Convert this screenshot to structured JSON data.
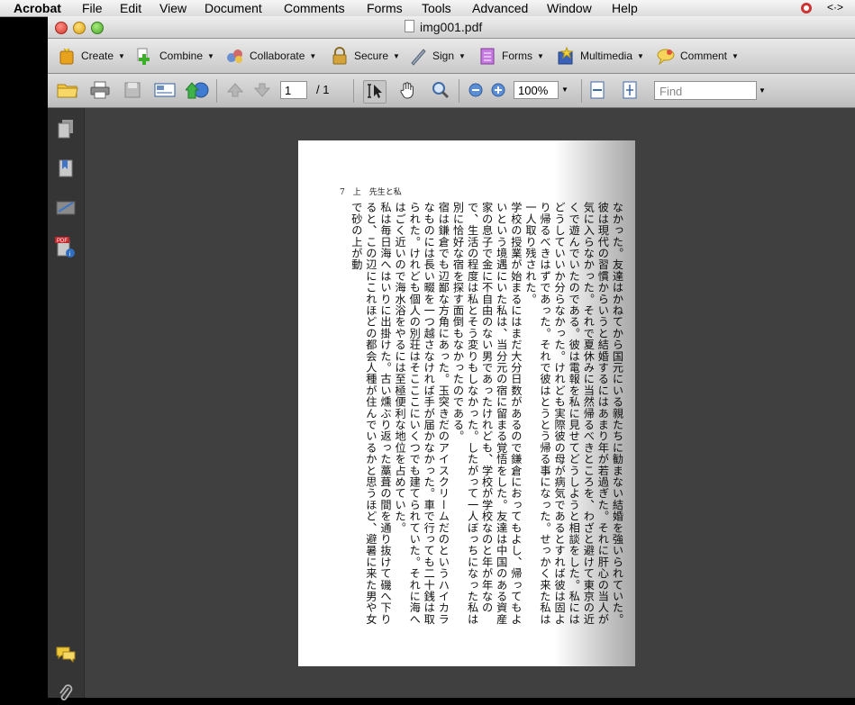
{
  "menubar": {
    "app_name": "Acrobat",
    "items": [
      "File",
      "Edit",
      "View",
      "Document",
      "Comments",
      "Forms",
      "Tools",
      "Advanced",
      "Window",
      "Help"
    ],
    "right_symbol": "<·>"
  },
  "window": {
    "title": "img001.pdf"
  },
  "toolbar1": [
    {
      "label": "Create",
      "icon": "create-icon"
    },
    {
      "label": "Combine",
      "icon": "combine-icon"
    },
    {
      "label": "Collaborate",
      "icon": "collaborate-icon"
    },
    {
      "label": "Secure",
      "icon": "lock-icon"
    },
    {
      "label": "Sign",
      "icon": "pen-icon"
    },
    {
      "label": "Forms",
      "icon": "forms-icon"
    },
    {
      "label": "Multimedia",
      "icon": "multimedia-icon"
    },
    {
      "label": "Comment",
      "icon": "comment-icon"
    }
  ],
  "toolbar2": {
    "page_current": "1",
    "page_total_label": "/ 1",
    "zoom": "100%",
    "find_placeholder": "Find"
  },
  "document": {
    "header": "7　上　先生と私",
    "paragraphs": [
      "なかった。友達はかねてから国元にいる親たちに勧まない結婚を強いられていた。彼は現代の習慣からいうと結婚するにはあまり年が若過ぎた。それに肝心の当人が気に入らなかった。それで夏休みに当然帰るべきところを、わざと避けて東京の近くで遊んでいたのである。彼は電報を私に見せてどうしようと相談をした。私にはどうしていいか分らなかった。けれども実際彼の母が病気であるとすれば彼は固より帰るべきはずであった。それで彼はとうとう帰る事になった。せっかく来た私は一人取り残された。",
      "学校の授業が始まるにはまだ大分日数があるので鎌倉におってもよし、帰ってもよいという境遇にいた私は、当分元の宿に留まる覚悟をした。友達は中国のある資産家の息子で金に不自由のない男であったけれども、学校が学校なのと年が年なので、生活の程度は私とそう変りもしなかった。したがって一人ぼっちになった私は別に恰好な宿を探す面倒もなかったのである。",
      "宿は鎌倉でも辺鄙な方角にあった。玉突きだのアイスクリームだのというハイカラなものには長い畷を一つ越さなければ手が届かなかった。車で行っても二十銭は取られた。けれども個人の別荘はそこここにいくつでも建てられていた。それに海へはごく近いので海水浴をやるには至極便利な地位を占めていた。",
      "私は毎日海へはいりに出掛けた。古い燻ぶり返った藁葺の間を通り抜けて磯へ下りると、この辺にこれほどの都会人種が住んでいるかと思うほど、避暑に来た男や女で砂の上が動"
    ]
  }
}
